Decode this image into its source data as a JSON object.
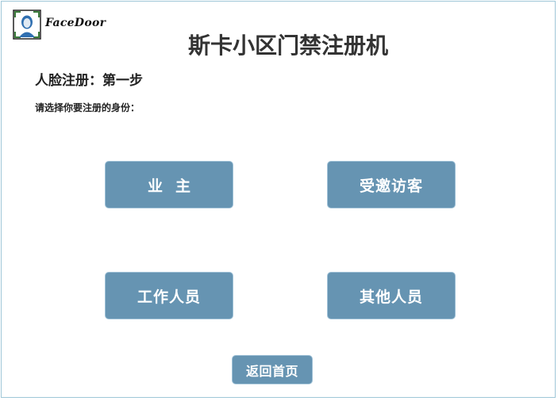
{
  "brand": {
    "name": "FaceDoor",
    "logo_icon": "face-scan-icon"
  },
  "title": "斯卡小区门禁注册机",
  "step_label": "人脸注册：第一步",
  "prompt": "请选择你要注册的身份：",
  "options": {
    "owner": "业主",
    "invited_visitor": "受邀访客",
    "staff": "工作人员",
    "other": "其他人员"
  },
  "back_button": "返回首页",
  "colors": {
    "button_bg": "#6694b2",
    "button_text": "#ffffff",
    "border": "#9fc7d8"
  }
}
